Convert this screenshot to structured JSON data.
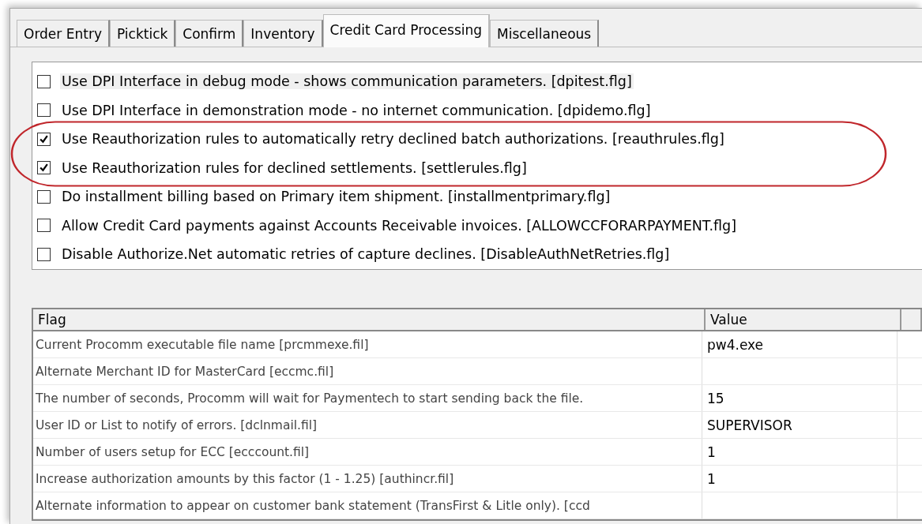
{
  "tabs": [
    {
      "label": "Order Entry",
      "selected": false
    },
    {
      "label": "Picktick",
      "selected": false
    },
    {
      "label": "Confirm",
      "selected": false
    },
    {
      "label": "Inventory",
      "selected": false
    },
    {
      "label": "Credit Card Processing",
      "selected": true
    },
    {
      "label": "Miscellaneous",
      "selected": false
    }
  ],
  "options": [
    {
      "label": "Use DPI Interface in debug mode - shows communication parameters. [dpitest.flg]",
      "checked": false,
      "highlighted": true
    },
    {
      "label": "Use DPI Interface in demonstration mode - no internet communication. [dpidemo.flg]",
      "checked": false,
      "highlighted": false
    },
    {
      "label": "Use Reauthorization rules to automatically retry declined batch authorizations. [reauthrules.flg]",
      "checked": true,
      "highlighted": false
    },
    {
      "label": "Use Reauthorization rules for declined settlements. [settlerules.flg]",
      "checked": true,
      "highlighted": false
    },
    {
      "label": "Do installment billing based on Primary item shipment. [installmentprimary.flg]",
      "checked": false,
      "highlighted": false
    },
    {
      "label": "Allow Credit Card payments against Accounts Receivable invoices. [ALLOWCCFORARPAYMENT.flg]",
      "checked": false,
      "highlighted": false
    },
    {
      "label": "Disable Authorize.Net automatic retries of capture declines. [DisableAuthNetRetries.flg]",
      "checked": false,
      "highlighted": false
    }
  ],
  "table": {
    "columns": [
      "Flag",
      "Value"
    ],
    "rows": [
      {
        "flag": "Current Procomm executable file name [prcmmexe.fil]",
        "value": "pw4.exe"
      },
      {
        "flag": "Alternate Merchant ID for MasterCard [eccmc.fil]"
      },
      {
        "flag": "The number of seconds, Procomm will wait for Paymentech to start sending back the file.",
        "value": "15"
      },
      {
        "flag": "User ID or List to notify of errors. [dclnmail.fil]",
        "value": "SUPERVISOR"
      },
      {
        "flag": "Number of users setup for ECC [ecccount.fil]",
        "value": "1"
      },
      {
        "flag": "Increase authorization amounts by this factor (1 - 1.25) [authincr.fil]",
        "value": "1"
      },
      {
        "flag": "Alternate information to appear on customer bank statement (TransFirst & Litle only). [ccd"
      }
    ]
  }
}
